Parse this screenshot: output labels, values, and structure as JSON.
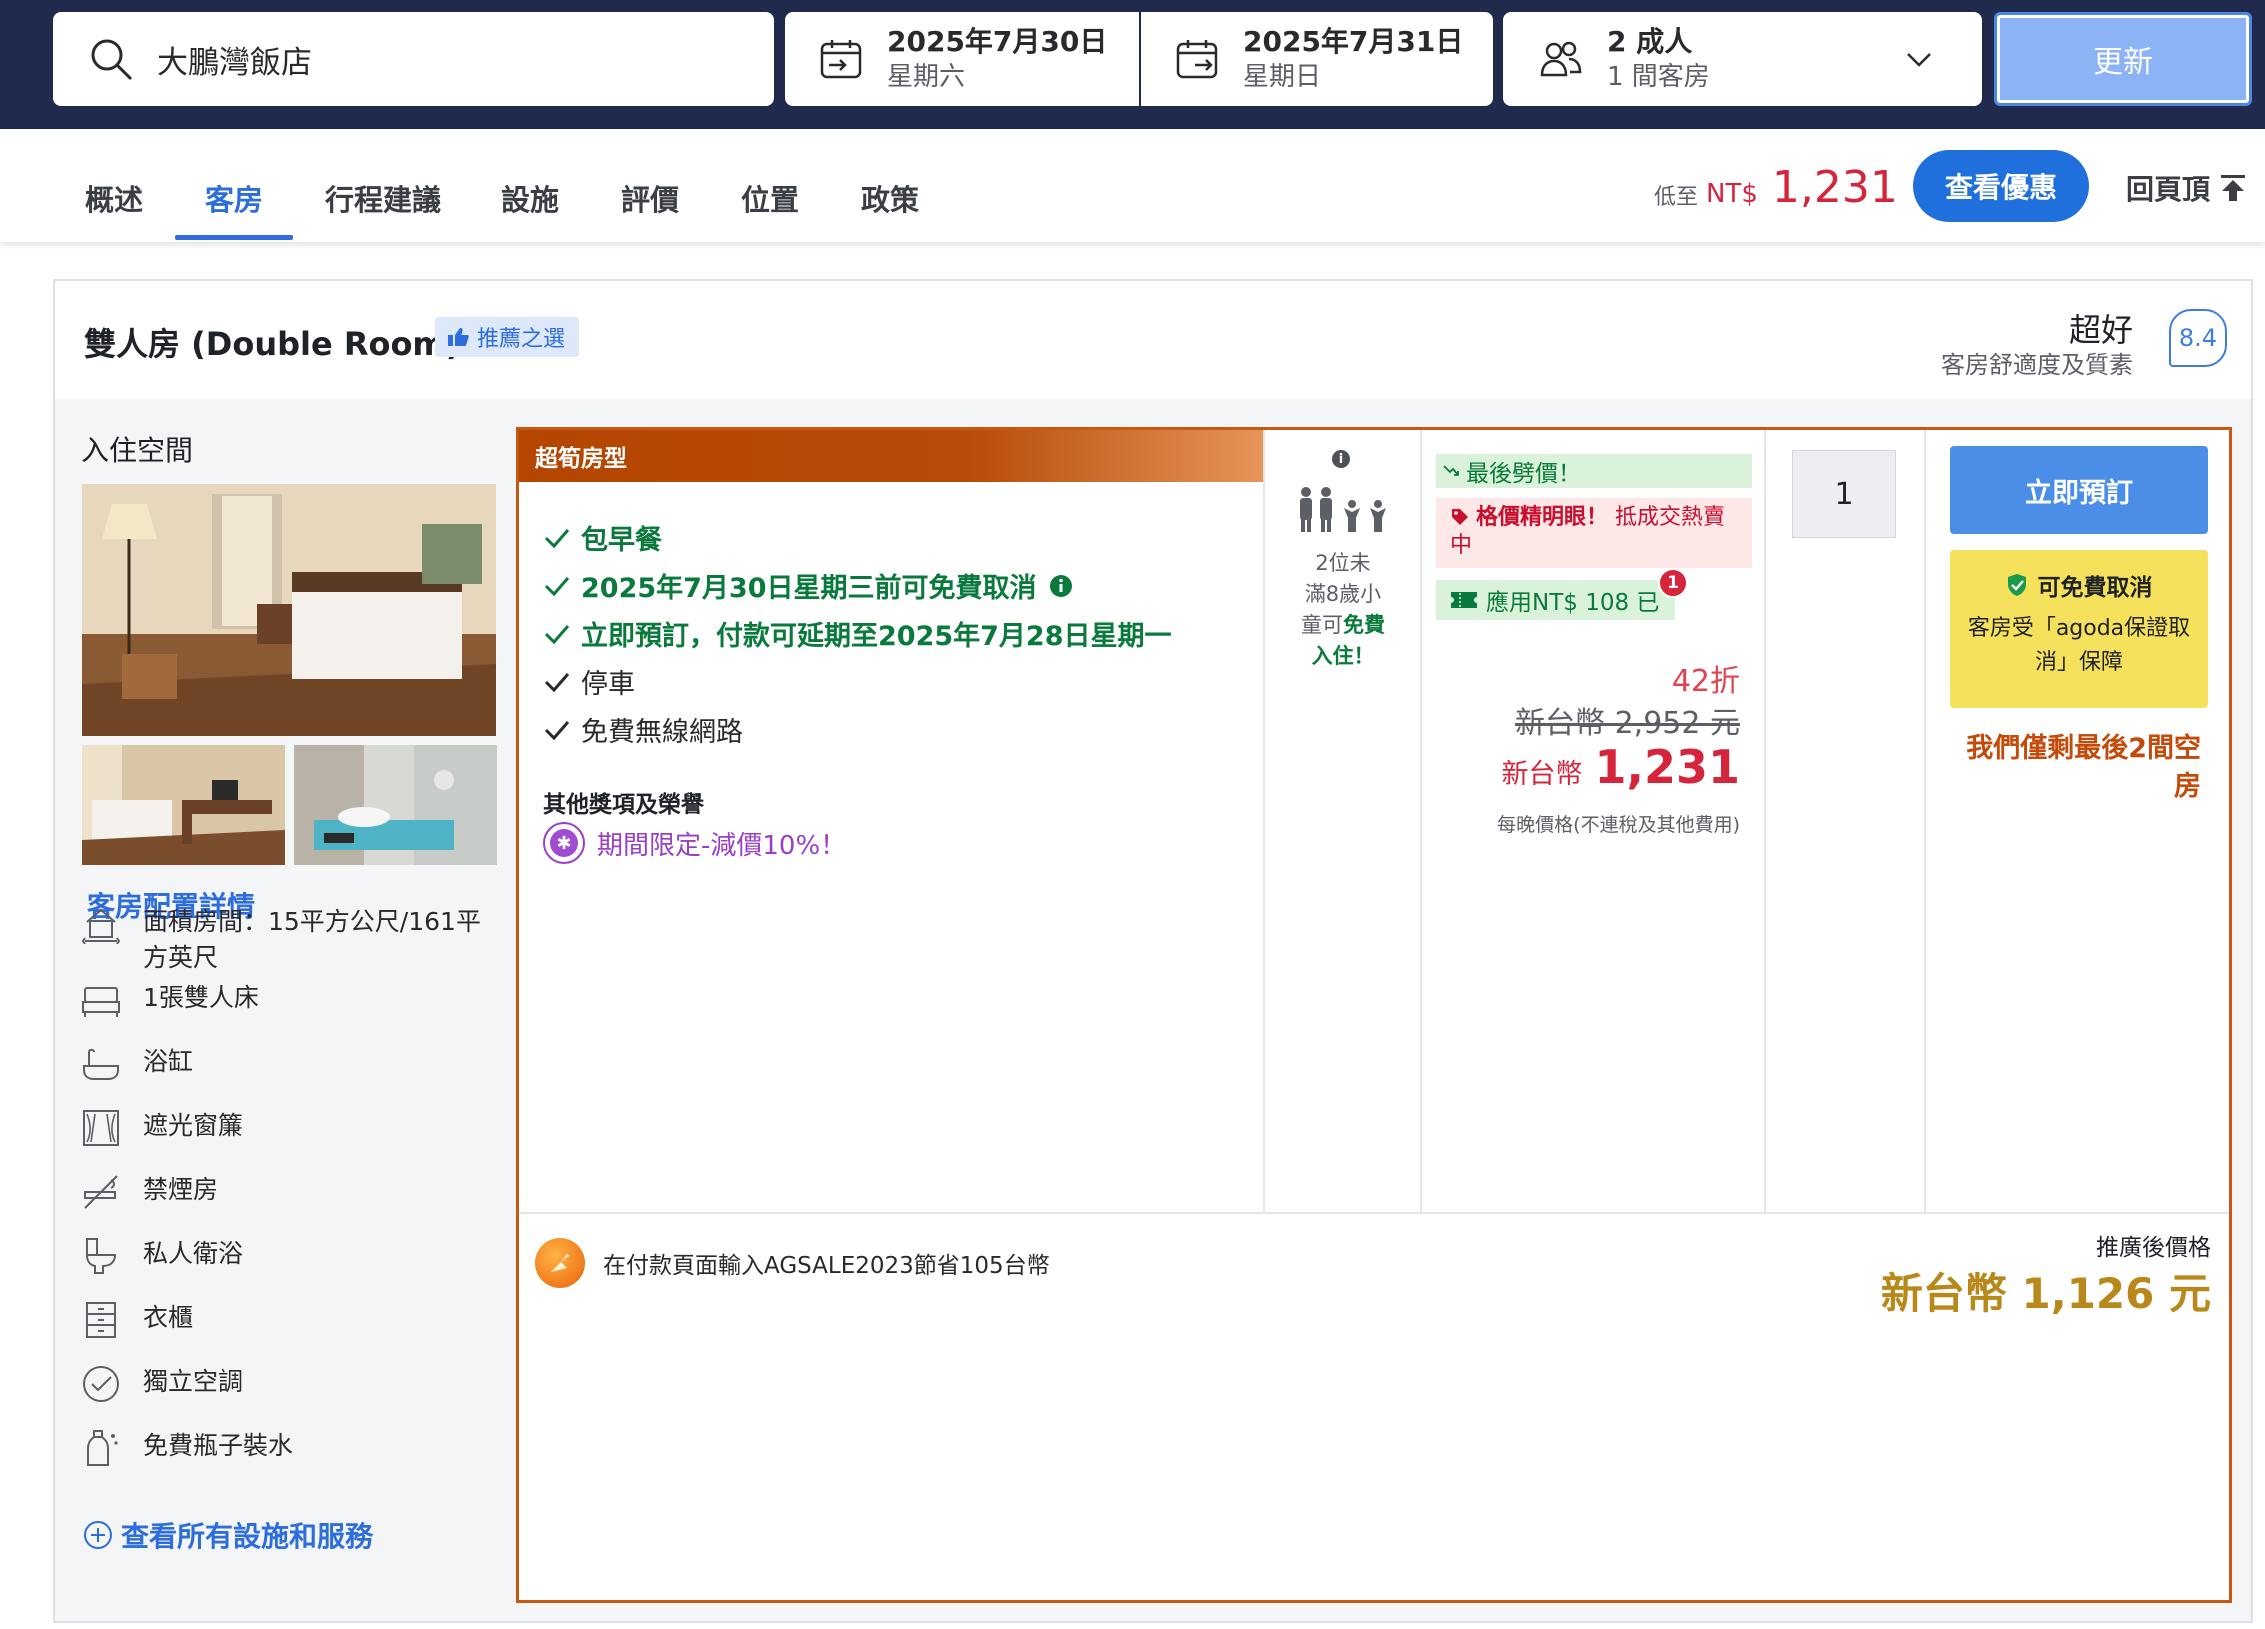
{
  "search": {
    "destination": "大鵬灣飯店",
    "checkin": {
      "date": "2025年7月30日",
      "weekday": "星期六"
    },
    "checkout": {
      "date": "2025年7月31日",
      "weekday": "星期日"
    },
    "occupancy": {
      "guests": "2 成人",
      "rooms": "1 間客房"
    },
    "update_label": "更新"
  },
  "nav": {
    "tabs": [
      {
        "label": "概述"
      },
      {
        "label": "客房"
      },
      {
        "label": "行程建議"
      },
      {
        "label": "設施"
      },
      {
        "label": "評價"
      },
      {
        "label": "位置"
      },
      {
        "label": "政策"
      }
    ],
    "active_tab": "客房",
    "from_label": "低至",
    "currency": "NT$",
    "lowest_price": "1,231",
    "deals_label": "查看優惠",
    "back_to_top": "回頁頂"
  },
  "room": {
    "name": "雙人房 (Double Room)",
    "recommended_badge": "推薦之選",
    "rating_word": "超好",
    "rating_sub": "客房舒適度及質素",
    "rating_score": "8.4",
    "space_title": "入住空間",
    "details_link": "客房配置詳情",
    "facilities": [
      {
        "label": "面積房間：15平方公尺/161平方英尺",
        "icon": "area-icon"
      },
      {
        "label": "1張雙人床",
        "icon": "bed-icon"
      },
      {
        "label": "浴缸",
        "icon": "bathtub-icon"
      },
      {
        "label": "遮光窗簾",
        "icon": "curtain-icon"
      },
      {
        "label": "禁煙房",
        "icon": "no-smoking-icon"
      },
      {
        "label": "私人衛浴",
        "icon": "toilet-icon"
      },
      {
        "label": "衣櫃",
        "icon": "wardrobe-icon"
      },
      {
        "label": "獨立空調",
        "icon": "aircon-icon"
      },
      {
        "label": "免費瓶子裝水",
        "icon": "water-bottle-icon"
      }
    ],
    "see_all": "查看所有設施和服務"
  },
  "offer": {
    "label": "超筍房型",
    "benefits": [
      {
        "label": "包早餐",
        "style": "green"
      },
      {
        "label": "2025年7月30日星期三前可免費取消",
        "style": "green"
      },
      {
        "label": "立即預訂，付款可延期至2025年7月28日星期一",
        "style": "green"
      },
      {
        "label": "停車",
        "style": "plain"
      },
      {
        "label": "免費無線網路",
        "style": "plain"
      }
    ],
    "other_heading": "其他獎項及榮譽",
    "promo": "期間限定-減價10%！",
    "occupancy_text_1": "2位未",
    "occupancy_text_2": "滿8歲小",
    "occupancy_text_3": "童可",
    "occupancy_free": "免費",
    "occupancy_text_4": "入住！",
    "tag_last_price": "最後劈價！",
    "tag_hot_bold": "格價精明眼！",
    "tag_hot_rest": "抵成交熱賣中",
    "tag_coupon": "應用NT$ 108 已",
    "coupon_badge": "1",
    "discount": "42折",
    "original_price": "新台幣 2,952 元",
    "final_currency": "新台幣",
    "final_price": "1,231",
    "per_night": "每晚價格(不連稅及其他費用)",
    "quantity": "1",
    "book_label": "立即預訂",
    "free_cancel_title": "可免費取消",
    "free_cancel_desc": "客房受「agoda保證取消」保障",
    "last_rooms": "我們僅剩最後2間空房",
    "coupon_text": "在付款頁面輸入AGSALE2023節省105台幣",
    "after_promo_label": "推廣後價格",
    "after_promo_price": "新台幣 1,126 元"
  },
  "colors": {
    "header_bg": "#1f2a4d",
    "brand_blue": "#2d6ddc",
    "offer_border": "#c75a12",
    "price_red": "#d6243b",
    "promo_gold": "#b8891a"
  }
}
